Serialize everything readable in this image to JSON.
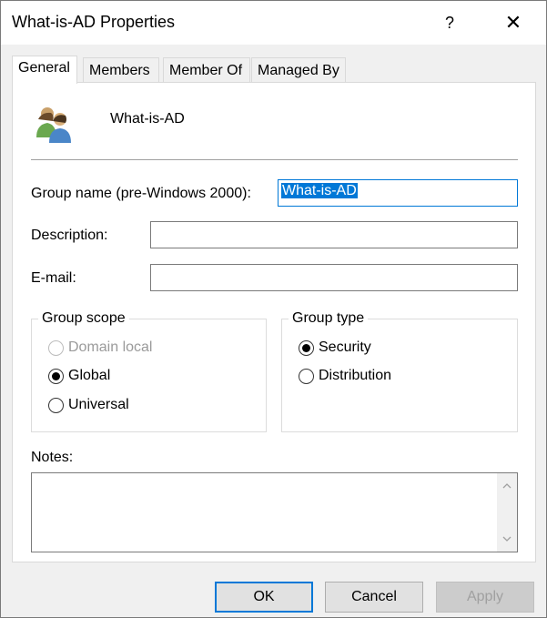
{
  "window": {
    "title": "What-is-AD Properties",
    "help_glyph": "?",
    "close_glyph": "✕"
  },
  "tabs": [
    {
      "label": "General",
      "active": true
    },
    {
      "label": "Members",
      "active": false
    },
    {
      "label": "Member Of",
      "active": false
    },
    {
      "label": "Managed By",
      "active": false
    }
  ],
  "general": {
    "object_name": "What-is-AD",
    "icon": "group-users-icon",
    "group_name_label": "Group name (pre-Windows 2000):",
    "group_name_value": "What-is-AD",
    "description_label": "Description:",
    "description_value": "",
    "email_label": "E-mail:",
    "email_value": "",
    "group_scope": {
      "legend": "Group scope",
      "options": [
        {
          "label": "Domain local",
          "checked": false,
          "enabled": false
        },
        {
          "label": "Global",
          "checked": true,
          "enabled": true
        },
        {
          "label": "Universal",
          "checked": false,
          "enabled": true
        }
      ]
    },
    "group_type": {
      "legend": "Group type",
      "options": [
        {
          "label": "Security",
          "checked": true,
          "enabled": true
        },
        {
          "label": "Distribution",
          "checked": false,
          "enabled": true
        }
      ]
    },
    "notes_label": "Notes:",
    "notes_value": ""
  },
  "buttons": {
    "ok": "OK",
    "cancel": "Cancel",
    "apply": "Apply"
  },
  "colors": {
    "accent": "#0078d7",
    "selection": "#0078d7"
  }
}
